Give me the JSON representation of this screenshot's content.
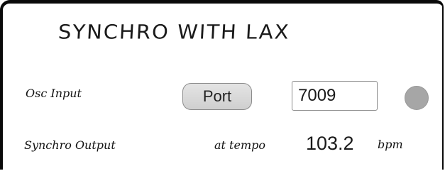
{
  "window": {
    "title": "SYNCHRO WITH LAX"
  },
  "osc_input": {
    "label": "Osc Input",
    "port_button_label": "Port",
    "port_value": "7009",
    "indicator_color": "#a6a6a6"
  },
  "synchro_output": {
    "label": "Synchro Output",
    "tempo_prefix": "at tempo",
    "tempo_value": "103.2",
    "tempo_unit": "bpm"
  }
}
